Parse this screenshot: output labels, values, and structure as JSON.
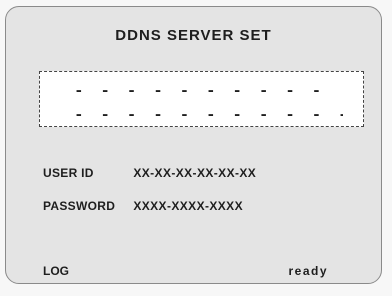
{
  "title": "DDNS SERVER SET",
  "server": {
    "line1": "- - - - - - - - - - - - - - -",
    "line2": "- - - - - - - - - - - - - - - -"
  },
  "user_id": {
    "label": "USER ID",
    "value": "XX-XX-XX-XX-XX-XX"
  },
  "password": {
    "label": "PASSWORD",
    "value": "XXXX-XXXX-XXXX"
  },
  "footer": {
    "log_label": "LOG",
    "status": "ready"
  }
}
